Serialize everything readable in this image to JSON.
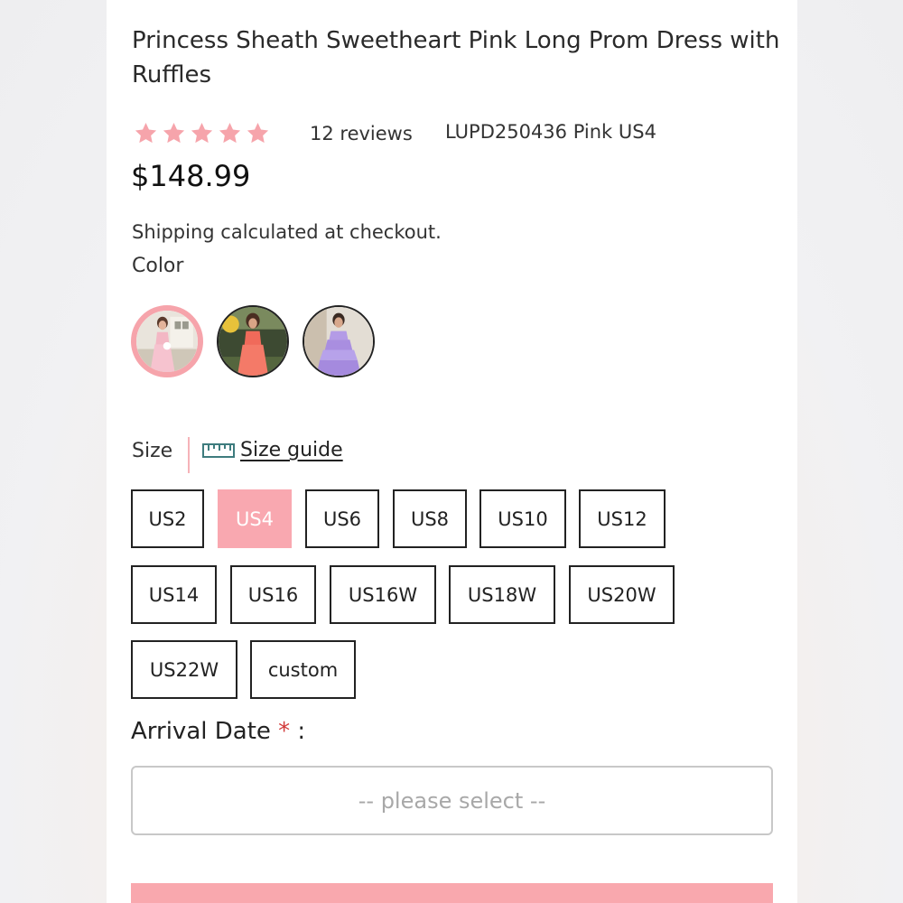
{
  "product": {
    "title": "Princess Sheath Sweetheart Pink Long Prom Dress with Ruffles",
    "rating": 5,
    "reviews": "12 reviews",
    "sku": "LUPD250436 Pink US4",
    "price": "$148.99",
    "shipping": "Shipping calculated at checkout."
  },
  "color": {
    "label": "Color",
    "swatches": [
      {
        "name": "pink",
        "selected": true,
        "accent": "#f3b7c4"
      },
      {
        "name": "coral",
        "selected": false,
        "accent": "#f06a5a"
      },
      {
        "name": "lilac",
        "selected": false,
        "accent": "#b49be6"
      }
    ]
  },
  "size": {
    "label": "Size",
    "guide_label": "Size guide",
    "options": [
      "US2",
      "US4",
      "US6",
      "US8",
      "US10",
      "US12",
      "US14",
      "US16",
      "US16W",
      "US18W",
      "US20W",
      "US22W",
      "custom"
    ],
    "selected": "US4"
  },
  "arrival": {
    "label": "Arrival Date",
    "required_mark": "*",
    "suffix": " :",
    "placeholder": "--  please select  --"
  },
  "colors": {
    "accent": "#f9a8b0",
    "star": "#f6a4ab",
    "required": "#d23a3a"
  },
  "icons": {
    "rating": "star-icon",
    "size_guide": "ruler-icon"
  }
}
